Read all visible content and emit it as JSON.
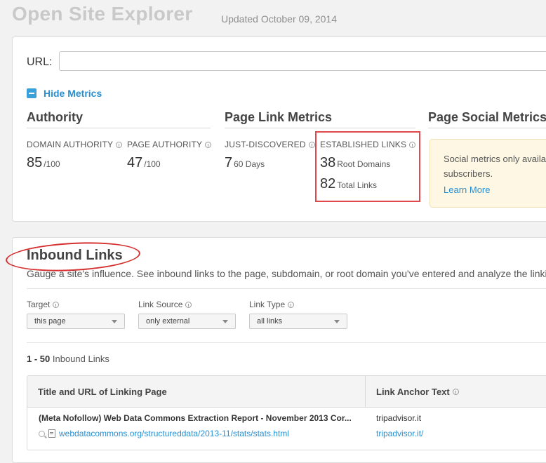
{
  "header": {
    "title": "Open Site Explorer",
    "updated": "Updated October 09, 2014"
  },
  "url_bar": {
    "label": "URL:",
    "value": ""
  },
  "toggle": {
    "label": "Hide Metrics"
  },
  "sections": {
    "authority": "Authority",
    "page_link_metrics": "Page Link Metrics",
    "page_social_metrics": "Page Social Metrics"
  },
  "metrics": {
    "domain_authority": {
      "label": "DOMAIN AUTHORITY",
      "value": "85",
      "unit": "/100"
    },
    "page_authority": {
      "label": "PAGE AUTHORITY",
      "value": "47",
      "unit": "/100"
    },
    "just_discovered": {
      "label": "JUST-DISCOVERED",
      "value": "7",
      "unit": "60 Days"
    },
    "established_links": {
      "label": "ESTABLISHED LINKS",
      "root_domains_value": "38",
      "root_domains_unit": "Root Domains",
      "total_links_value": "82",
      "total_links_unit": "Total Links"
    }
  },
  "social_notice": {
    "line1": "Social metrics only availab",
    "line2": "subscribers.",
    "link": "Learn More"
  },
  "inbound": {
    "title": "Inbound Links",
    "description": "Gauge a site's influence. See inbound links to the page, subdomain, or root domain you've entered and analyze the linki",
    "filters": [
      {
        "label": "Target",
        "value": "this page"
      },
      {
        "label": "Link Source",
        "value": "only external"
      },
      {
        "label": "Link Type",
        "value": "all links"
      }
    ],
    "count_range": "1 - 50",
    "count_suffix": "Inbound Links"
  },
  "table": {
    "columns": [
      "Title and URL of Linking Page",
      "Link Anchor Text"
    ],
    "rows": [
      {
        "title": "(Meta Nofollow) Web Data Commons Extraction Report - November 2013 Cor...",
        "url": "webdatacommons.org/structureddata/2013-11/stats/stats.html",
        "anchor_text": "tripadvisor.it",
        "anchor_url": "tripadvisor.it/"
      }
    ]
  },
  "colors": {
    "accent": "#2a8fd0",
    "highlight": "#e0484b",
    "social_bg": "#fdf7e3"
  }
}
